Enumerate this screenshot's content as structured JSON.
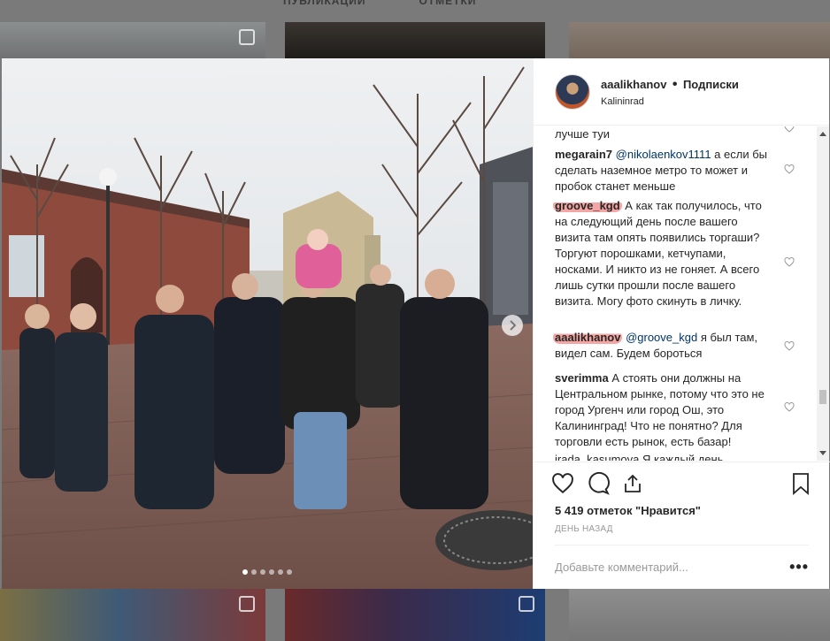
{
  "profile_tabs": [
    "ПУБЛИКАЦИИ",
    "ОТМЕТКИ"
  ],
  "post": {
    "username": "aaalikhanov",
    "separator": "•",
    "follow_label": "Подписки",
    "location": "Kalininrad"
  },
  "comments": {
    "partial_top": "лучше туи",
    "items": [
      {
        "user": "megarain7",
        "mention": "@nikolaenkov1111",
        "text": " а если бы сделать наземное метро то может и пробок станет меньше"
      },
      {
        "user": "groove_kgd",
        "mention": "",
        "text": " А как так получилось, что на следующий день после вашего визита там опять появились торгаши? Торгуют порошками, кетчупами, носками. И никто из не гоняет. А всего лишь сутки прошли после вашего визита. Могу фото скинуть в личку."
      },
      {
        "user": "aaalikhanov",
        "mention": "@groove_kgd",
        "text": " я был там, видел сам. Будем бороться"
      },
      {
        "user": "sverimma",
        "mention": "",
        "text": " А стоять они должны на Центральном рынке, потому что это не город Ургенч или город Ош, это Калининград! Что не понятно? Для торговли есть рынок, есть базар!"
      }
    ],
    "partial_bottom": "irada_kasumova Я каждый день"
  },
  "likes_text": "5 419 отметок \"Нравится\"",
  "date_text": "ДЕНЬ НАЗАД",
  "add_comment_placeholder": "Добавьте комментарий...",
  "more_label": "•••",
  "carousel": {
    "count": 6,
    "active": 0
  },
  "colors": {
    "highlight": "#f3a6a3",
    "mention": "#003569",
    "text": "#262626",
    "muted": "#999999"
  }
}
